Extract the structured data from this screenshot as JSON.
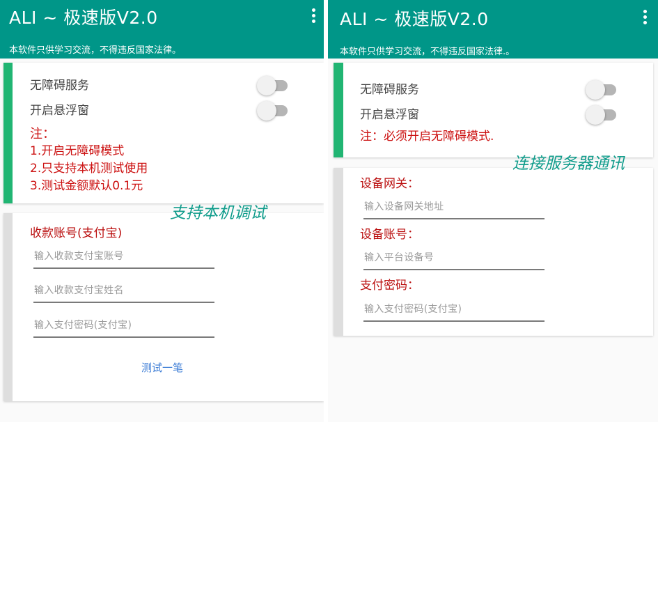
{
  "left_screen": {
    "appbar": {
      "title": "ALI ~ 极速版V2.0",
      "subtitle": "本软件只供学习交流，不得违反国家法律。"
    },
    "settings_card": {
      "accent_color": "#21b573",
      "accessibility_label": "无障碍服务",
      "accessibility_enabled": false,
      "floating_window_label": "开启悬浮窗",
      "floating_window_enabled": false,
      "note_title": "注：",
      "note_lines": [
        "1.开启无障碍模式",
        "2.只支持本机测试使用",
        "3.测试金额默认0.1元"
      ]
    },
    "annotation": "支持本机调试",
    "account_card": {
      "section_label": "收款账号(支付宝)",
      "account_placeholder": "输入收款支付宝账号",
      "name_placeholder": "输入收款支付宝姓名",
      "password_placeholder": "输入支付密码(支付宝)",
      "test_button": "测试一笔"
    }
  },
  "right_screen": {
    "appbar": {
      "title": "ALI ~ 极速版V2.0",
      "subtitle": "本软件只供学习交流，不得违反国家法律.。"
    },
    "settings_card": {
      "accent_color": "#21b573",
      "accessibility_label": "无障碍服务",
      "accessibility_enabled": false,
      "floating_window_label": "开启悬浮窗",
      "floating_window_enabled": false,
      "note": "注：必须开启无障碍模式."
    },
    "annotation": "连接服务器通讯",
    "server_card": {
      "gateway_label": "设备网关：",
      "gateway_placeholder": "输入设备网关地址",
      "device_label": "设备账号：",
      "device_placeholder": "输入平台设备号",
      "password_label": "支付密码：",
      "password_placeholder": "输入支付密码(支付宝)"
    }
  },
  "colors": {
    "appbar": "#009688",
    "accent_green": "#21b573",
    "note_red": "#cc1111",
    "annotation_teal": "#0f9c8b",
    "link_blue": "#3a7bd5"
  }
}
